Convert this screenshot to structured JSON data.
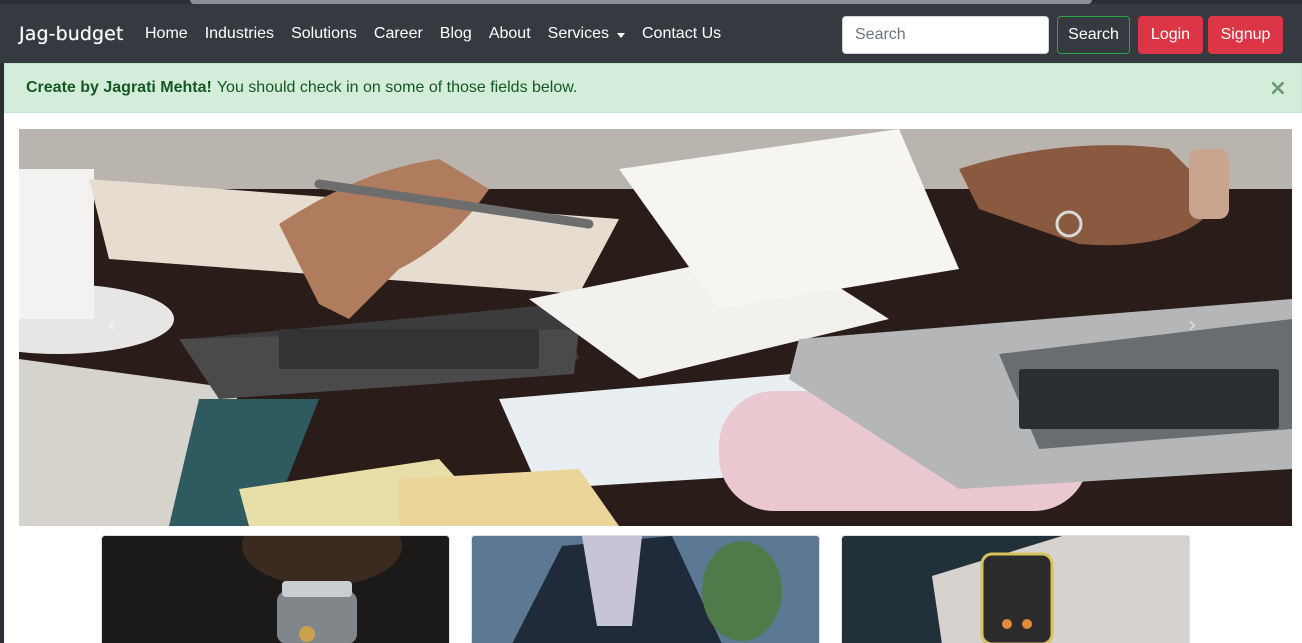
{
  "navbar": {
    "brand": "Jag-budget",
    "links": [
      "Home",
      "Industries",
      "Solutions",
      "Career",
      "Blog",
      "About",
      "Services",
      "Contact Us"
    ],
    "search_placeholder": "Search",
    "search_button": "Search",
    "login_button": "Login",
    "signup_button": "Signup"
  },
  "alert": {
    "strong": "Create by Jagrati Mehta!",
    "message": "You should check in on some of those fields below.",
    "close": "×"
  },
  "carousel": {
    "prev_icon": "chevron-left-icon",
    "next_icon": "chevron-right-icon",
    "prev_glyph": "‹",
    "next_glyph": "›"
  },
  "cards": [
    {
      "image": "savings-jar-photo"
    },
    {
      "image": "businessman-desk-photo"
    },
    {
      "image": "phone-calculator-photo"
    }
  ],
  "colors": {
    "navbar_bg": "#343a40",
    "alert_bg": "#d4edda",
    "alert_text": "#155724",
    "danger": "#dc3545",
    "success_outline": "#28a745"
  }
}
